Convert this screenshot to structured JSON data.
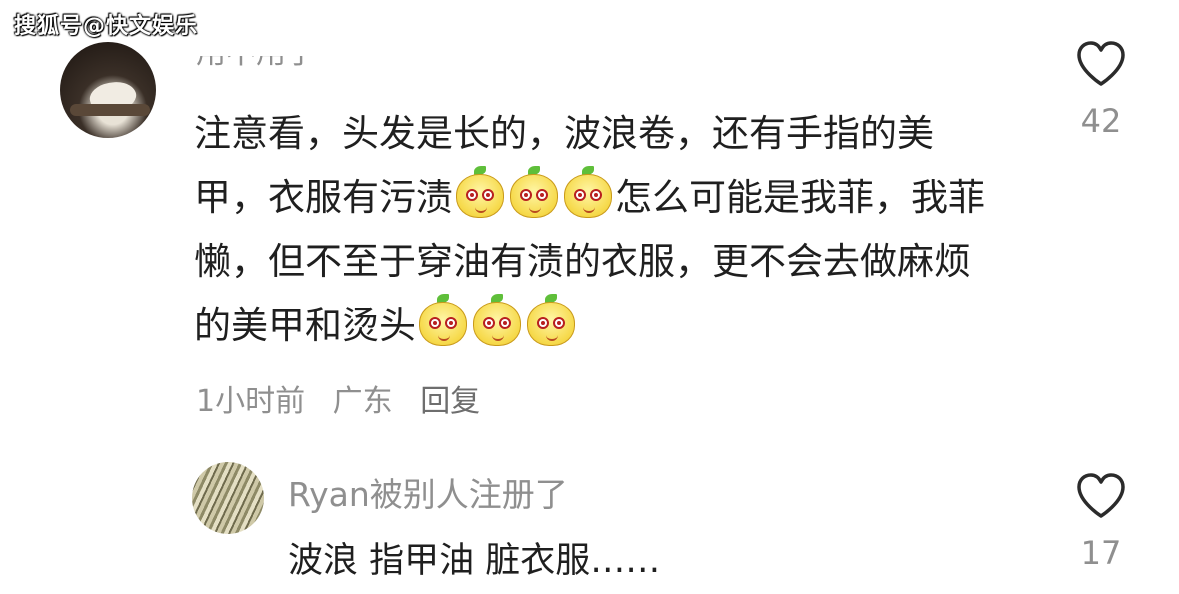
{
  "watermark": "搜狐号@快文娱乐",
  "comment": {
    "author_partial": "用不用了",
    "text_segments": {
      "s1": "注意看，头发是长的，波浪卷，还有手指的美甲，衣服有污渍",
      "s2": "怎么可能是我菲，我菲懒，但不至于穿油有渍的衣服，更不会去做麻烦的美甲和烫头"
    },
    "emoji_name": "yellow-pear-emoji",
    "time": "1小时前",
    "location": "广东",
    "reply_label": "回复",
    "like_count": "42"
  },
  "reply": {
    "author": "Ryan被别人注册了",
    "text": "波浪 指甲油 脏衣服……",
    "like_count": "17"
  },
  "colors": {
    "text": "#1f1f1f",
    "meta": "#8f8f8f",
    "heart": "#2b2b2b"
  }
}
